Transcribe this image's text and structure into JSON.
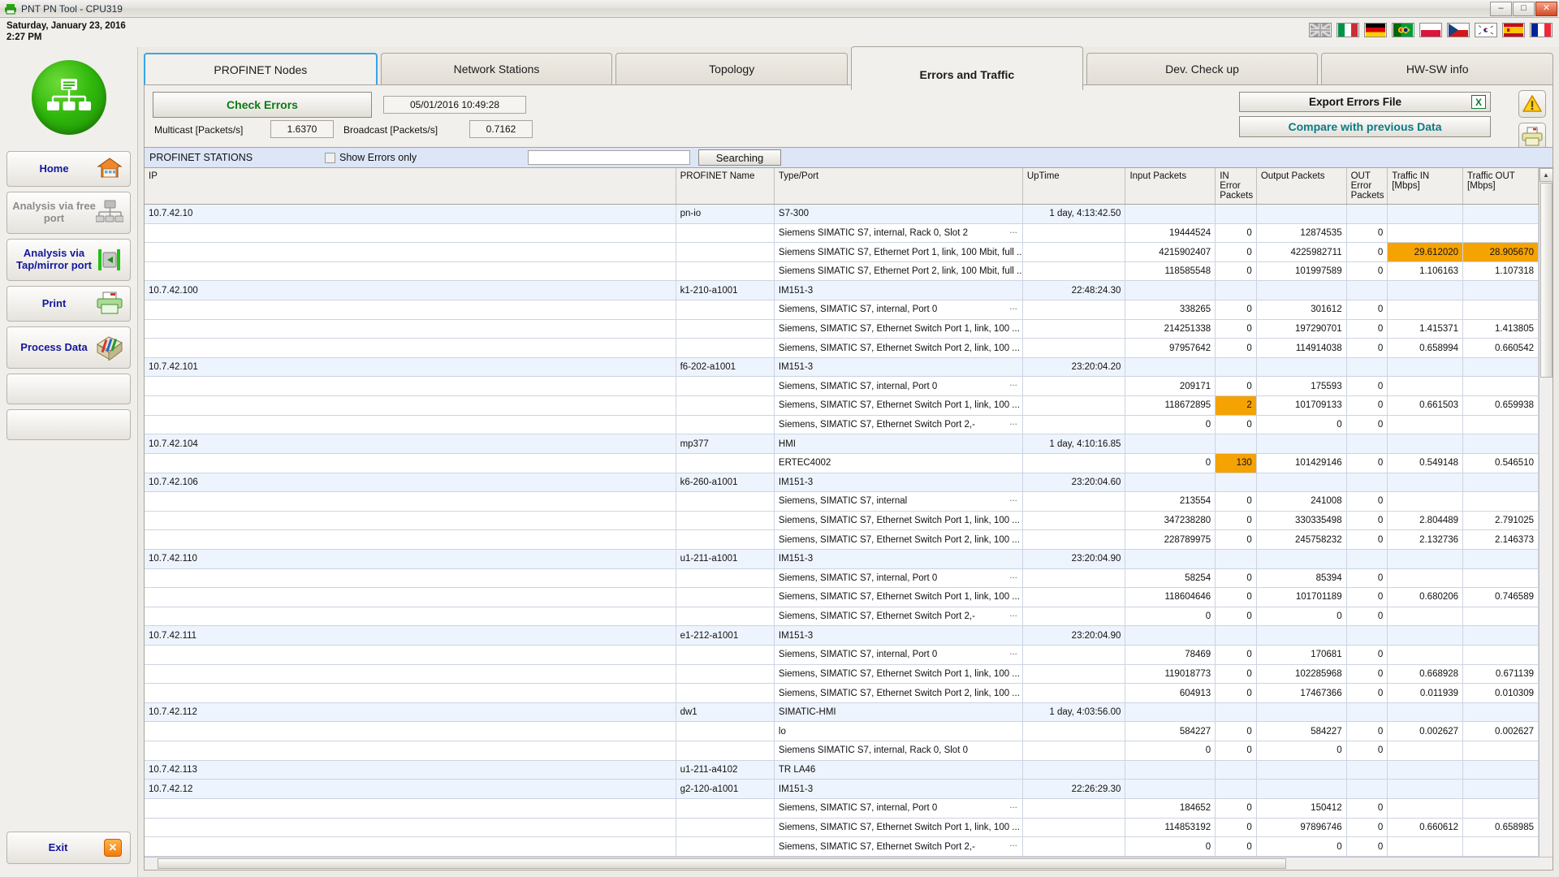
{
  "window": {
    "title": "PNT PN Tool - CPU319",
    "icon": "printer-icon",
    "minimize": "–",
    "maximize": "□",
    "close": "✕"
  },
  "header": {
    "date": "Saturday, January 23, 2016",
    "time": "2:27 PM",
    "flags": [
      {
        "name": "flag-uk",
        "title": "English"
      },
      {
        "name": "flag-italy",
        "title": "Italiano"
      },
      {
        "name": "flag-germany",
        "title": "Deutsch"
      },
      {
        "name": "flag-portugal-brazil",
        "title": "Português"
      },
      {
        "name": "flag-poland",
        "title": "Polski"
      },
      {
        "name": "flag-czech",
        "title": "Čeština"
      },
      {
        "name": "flag-south-korea",
        "title": "한국어"
      },
      {
        "name": "flag-spain",
        "title": "Español"
      },
      {
        "name": "flag-france",
        "title": "Français"
      }
    ]
  },
  "sidebar": {
    "items": [
      {
        "label": "Home",
        "icon": "house-icon",
        "state": "enabled"
      },
      {
        "label": "Analysis via free port",
        "icon": "network-tree-icon",
        "state": "disabled"
      },
      {
        "label": "Analysis via Tap/mirror port",
        "icon": "tap-mirror-icon",
        "state": "enabled"
      },
      {
        "label": "Print",
        "icon": "printer-icon",
        "state": "enabled"
      },
      {
        "label": "Process Data",
        "icon": "process-data-icon",
        "state": "enabled"
      },
      {
        "label": "",
        "icon": "",
        "state": "empty"
      },
      {
        "label": "",
        "icon": "",
        "state": "empty"
      }
    ],
    "exit": {
      "label": "Exit",
      "icon": "close-x-icon"
    }
  },
  "tabs": [
    {
      "label": "PROFINET Nodes",
      "state": "selected"
    },
    {
      "label": "Network Stations",
      "state": "normal"
    },
    {
      "label": "Topology",
      "state": "normal"
    },
    {
      "label": "Errors and Traffic",
      "state": "active"
    },
    {
      "label": "Dev. Check up",
      "state": "normal"
    },
    {
      "label": "HW-SW info",
      "state": "normal"
    }
  ],
  "controls": {
    "check_errors_label": "Check Errors",
    "timestamp": "05/01/2016   10:49:28",
    "multicast_label": "Multicast [Packets/s]",
    "multicast_value": "1.6370",
    "broadcast_label": "Broadcast [Packets/s]",
    "broadcast_value": "0.7162",
    "export_label": "Export Errors File",
    "export_icon": "excel-icon",
    "export_icon_glyph": "X",
    "compare_label": "Compare with previous Data",
    "warning_icon": "warning-triangle-icon",
    "print_icon": "printer-icon"
  },
  "stations_bar": {
    "title": "PROFINET STATIONS",
    "show_errors_label": "Show Errors only",
    "show_errors_checked": false,
    "search_value": "",
    "search_placeholder": "",
    "search_button": "Searching"
  },
  "table": {
    "columns": [
      "IP",
      "PROFINET Name",
      "Type/Port",
      "UpTime",
      "Input Packets",
      "IN Error Packets",
      "Output Packets",
      "OUT Error Packets",
      "Traffic IN [Mbps]",
      "Traffic OUT [Mbps]"
    ],
    "rows": [
      {
        "kind": "group",
        "ip": "10.7.42.10",
        "name": "pn-io",
        "type": "S7-300",
        "uptime": "1 day, 4:13:42.50",
        "in_pk": "",
        "in_err": "",
        "out_pk": "",
        "out_err": "",
        "t_in": "",
        "t_out": ""
      },
      {
        "kind": "child",
        "ip": "",
        "name": "",
        "type": "Siemens SIMATIC S7, internal, Rack 0, Slot 2",
        "ell": true,
        "uptime": "",
        "in_pk": "19444524",
        "in_err": "0",
        "out_pk": "12874535",
        "out_err": "0",
        "t_in": "",
        "t_out": ""
      },
      {
        "kind": "child",
        "ip": "",
        "name": "",
        "type": "Siemens SIMATIC S7, Ethernet Port 1, link, 100 Mbit, full ...",
        "uptime": "",
        "in_pk": "4215902407",
        "in_err": "0",
        "out_pk": "4225982711",
        "out_err": "0",
        "t_in": "29.612020",
        "t_out": "28.905670",
        "hl_t_in": true,
        "hl_t_out": true
      },
      {
        "kind": "child",
        "ip": "",
        "name": "",
        "type": "Siemens SIMATIC S7, Ethernet Port 2, link, 100 Mbit, full ...",
        "uptime": "",
        "in_pk": "118585548",
        "in_err": "0",
        "out_pk": "101997589",
        "out_err": "0",
        "t_in": "1.106163",
        "t_out": "1.107318"
      },
      {
        "kind": "group",
        "ip": "10.7.42.100",
        "name": "k1-210-a1001",
        "type": "IM151-3",
        "uptime": "22:48:24.30",
        "in_pk": "",
        "in_err": "",
        "out_pk": "",
        "out_err": "",
        "t_in": "",
        "t_out": ""
      },
      {
        "kind": "child",
        "ip": "",
        "name": "",
        "type": "Siemens, SIMATIC S7, internal, Port 0",
        "ell": true,
        "uptime": "",
        "in_pk": "338265",
        "in_err": "0",
        "out_pk": "301612",
        "out_err": "0",
        "t_in": "",
        "t_out": ""
      },
      {
        "kind": "child",
        "ip": "",
        "name": "",
        "type": "Siemens, SIMATIC S7, Ethernet Switch Port 1, link, 100 ...",
        "uptime": "",
        "in_pk": "214251338",
        "in_err": "0",
        "out_pk": "197290701",
        "out_err": "0",
        "t_in": "1.415371",
        "t_out": "1.413805"
      },
      {
        "kind": "child",
        "ip": "",
        "name": "",
        "type": "Siemens, SIMATIC S7, Ethernet Switch Port 2, link, 100 ...",
        "uptime": "",
        "in_pk": "97957642",
        "in_err": "0",
        "out_pk": "114914038",
        "out_err": "0",
        "t_in": "0.658994",
        "t_out": "0.660542"
      },
      {
        "kind": "group",
        "ip": "10.7.42.101",
        "name": "f6-202-a1001",
        "type": "IM151-3",
        "uptime": "23:20:04.20",
        "in_pk": "",
        "in_err": "",
        "out_pk": "",
        "out_err": "",
        "t_in": "",
        "t_out": ""
      },
      {
        "kind": "child",
        "ip": "",
        "name": "",
        "type": "Siemens, SIMATIC S7, internal, Port 0",
        "ell": true,
        "uptime": "",
        "in_pk": "209171",
        "in_err": "0",
        "out_pk": "175593",
        "out_err": "0",
        "t_in": "",
        "t_out": ""
      },
      {
        "kind": "child",
        "ip": "",
        "name": "",
        "type": "Siemens, SIMATIC S7, Ethernet Switch Port 1, link, 100 ...",
        "uptime": "",
        "in_pk": "118672895",
        "in_err": "2",
        "out_pk": "101709133",
        "out_err": "0",
        "t_in": "0.661503",
        "t_out": "0.659938",
        "hl_in_err": true
      },
      {
        "kind": "child",
        "ip": "",
        "name": "",
        "type": "Siemens, SIMATIC S7, Ethernet Switch Port 2,-",
        "ell": true,
        "uptime": "",
        "in_pk": "0",
        "in_err": "0",
        "out_pk": "0",
        "out_err": "0",
        "t_in": "",
        "t_out": ""
      },
      {
        "kind": "group",
        "ip": "10.7.42.104",
        "name": "mp377",
        "type": "HMI",
        "uptime": "1 day, 4:10:16.85",
        "in_pk": "",
        "in_err": "",
        "out_pk": "",
        "out_err": "",
        "t_in": "",
        "t_out": ""
      },
      {
        "kind": "child",
        "ip": "",
        "name": "",
        "type": "ERTEC4002",
        "uptime": "",
        "in_pk": "0",
        "in_err": "130",
        "out_pk": "101429146",
        "out_err": "0",
        "t_in": "0.549148",
        "t_out": "0.546510",
        "hl_in_err": true
      },
      {
        "kind": "group",
        "ip": "10.7.42.106",
        "name": "k6-260-a1001",
        "type": "IM151-3",
        "uptime": "23:20:04.60",
        "in_pk": "",
        "in_err": "",
        "out_pk": "",
        "out_err": "",
        "t_in": "",
        "t_out": ""
      },
      {
        "kind": "child",
        "ip": "",
        "name": "",
        "type": "Siemens, SIMATIC S7, internal",
        "ell": true,
        "uptime": "",
        "in_pk": "213554",
        "in_err": "0",
        "out_pk": "241008",
        "out_err": "0",
        "t_in": "",
        "t_out": ""
      },
      {
        "kind": "child",
        "ip": "",
        "name": "",
        "type": "Siemens, SIMATIC S7, Ethernet Switch Port 1, link, 100 ...",
        "uptime": "",
        "in_pk": "347238280",
        "in_err": "0",
        "out_pk": "330335498",
        "out_err": "0",
        "t_in": "2.804489",
        "t_out": "2.791025"
      },
      {
        "kind": "child",
        "ip": "",
        "name": "",
        "type": "Siemens, SIMATIC S7, Ethernet Switch Port 2, link, 100 ...",
        "uptime": "",
        "in_pk": "228789975",
        "in_err": "0",
        "out_pk": "245758232",
        "out_err": "0",
        "t_in": "2.132736",
        "t_out": "2.146373"
      },
      {
        "kind": "group",
        "ip": "10.7.42.110",
        "name": "u1-211-a1001",
        "type": "IM151-3",
        "uptime": "23:20:04.90",
        "in_pk": "",
        "in_err": "",
        "out_pk": "",
        "out_err": "",
        "t_in": "",
        "t_out": ""
      },
      {
        "kind": "child",
        "ip": "",
        "name": "",
        "type": "Siemens, SIMATIC S7, internal, Port 0",
        "ell": true,
        "uptime": "",
        "in_pk": "58254",
        "in_err": "0",
        "out_pk": "85394",
        "out_err": "0",
        "t_in": "",
        "t_out": ""
      },
      {
        "kind": "child",
        "ip": "",
        "name": "",
        "type": "Siemens, SIMATIC S7, Ethernet Switch Port 1, link, 100 ...",
        "uptime": "",
        "in_pk": "118604646",
        "in_err": "0",
        "out_pk": "101701189",
        "out_err": "0",
        "t_in": "0.680206",
        "t_out": "0.746589"
      },
      {
        "kind": "child",
        "ip": "",
        "name": "",
        "type": "Siemens, SIMATIC S7, Ethernet Switch Port 2,-",
        "ell": true,
        "uptime": "",
        "in_pk": "0",
        "in_err": "0",
        "out_pk": "0",
        "out_err": "0",
        "t_in": "",
        "t_out": ""
      },
      {
        "kind": "group",
        "ip": "10.7.42.111",
        "name": "e1-212-a1001",
        "type": "IM151-3",
        "uptime": "23:20:04.90",
        "in_pk": "",
        "in_err": "",
        "out_pk": "",
        "out_err": "",
        "t_in": "",
        "t_out": ""
      },
      {
        "kind": "child",
        "ip": "",
        "name": "",
        "type": "Siemens, SIMATIC S7, internal, Port 0",
        "ell": true,
        "uptime": "",
        "in_pk": "78469",
        "in_err": "0",
        "out_pk": "170681",
        "out_err": "0",
        "t_in": "",
        "t_out": ""
      },
      {
        "kind": "child",
        "ip": "",
        "name": "",
        "type": "Siemens, SIMATIC S7, Ethernet Switch Port 1, link, 100 ...",
        "uptime": "",
        "in_pk": "119018773",
        "in_err": "0",
        "out_pk": "102285968",
        "out_err": "0",
        "t_in": "0.668928",
        "t_out": "0.671139"
      },
      {
        "kind": "child",
        "ip": "",
        "name": "",
        "type": "Siemens, SIMATIC S7, Ethernet Switch Port 2, link, 100 ...",
        "uptime": "",
        "in_pk": "604913",
        "in_err": "0",
        "out_pk": "17467366",
        "out_err": "0",
        "t_in": "0.011939",
        "t_out": "0.010309"
      },
      {
        "kind": "group",
        "ip": "10.7.42.112",
        "name": "dw1",
        "type": "SIMATIC-HMI",
        "uptime": "1 day, 4:03:56.00",
        "in_pk": "",
        "in_err": "",
        "out_pk": "",
        "out_err": "",
        "t_in": "",
        "t_out": ""
      },
      {
        "kind": "child",
        "ip": "",
        "name": "",
        "type": "lo",
        "uptime": "",
        "in_pk": "584227",
        "in_err": "0",
        "out_pk": "584227",
        "out_err": "0",
        "t_in": "0.002627",
        "t_out": "0.002627"
      },
      {
        "kind": "child",
        "ip": "",
        "name": "",
        "type": "Siemens SIMATIC S7, internal, Rack 0, Slot 0",
        "uptime": "",
        "in_pk": "0",
        "in_err": "0",
        "out_pk": "0",
        "out_err": "0",
        "t_in": "",
        "t_out": ""
      },
      {
        "kind": "group",
        "ip": "10.7.42.113",
        "name": "u1-211-a4102",
        "type": "TR LA46",
        "uptime": "",
        "in_pk": "",
        "in_err": "",
        "out_pk": "",
        "out_err": "",
        "t_in": "",
        "t_out": ""
      },
      {
        "kind": "group",
        "ip": "10.7.42.12",
        "name": "g2-120-a1001",
        "type": "IM151-3",
        "uptime": "22:26:29.30",
        "in_pk": "",
        "in_err": "",
        "out_pk": "",
        "out_err": "",
        "t_in": "",
        "t_out": ""
      },
      {
        "kind": "child",
        "ip": "",
        "name": "",
        "type": "Siemens, SIMATIC S7, internal, Port 0",
        "ell": true,
        "uptime": "",
        "in_pk": "184652",
        "in_err": "0",
        "out_pk": "150412",
        "out_err": "0",
        "t_in": "",
        "t_out": ""
      },
      {
        "kind": "child",
        "ip": "",
        "name": "",
        "type": "Siemens, SIMATIC S7, Ethernet Switch Port 1, link, 100 ...",
        "uptime": "",
        "in_pk": "114853192",
        "in_err": "0",
        "out_pk": "97896746",
        "out_err": "0",
        "t_in": "0.660612",
        "t_out": "0.658985"
      },
      {
        "kind": "child",
        "ip": "",
        "name": "",
        "type": "Siemens, SIMATIC S7, Ethernet Switch Port 2,-",
        "ell": true,
        "uptime": "",
        "in_pk": "0",
        "in_err": "0",
        "out_pk": "0",
        "out_err": "0",
        "t_in": "",
        "t_out": ""
      }
    ]
  },
  "colors": {
    "highlight": "#f5a203",
    "group_row": "#eef4fd",
    "accent_blue": "#13179c",
    "teal": "#0a7b86",
    "green": "#0b7a14"
  }
}
